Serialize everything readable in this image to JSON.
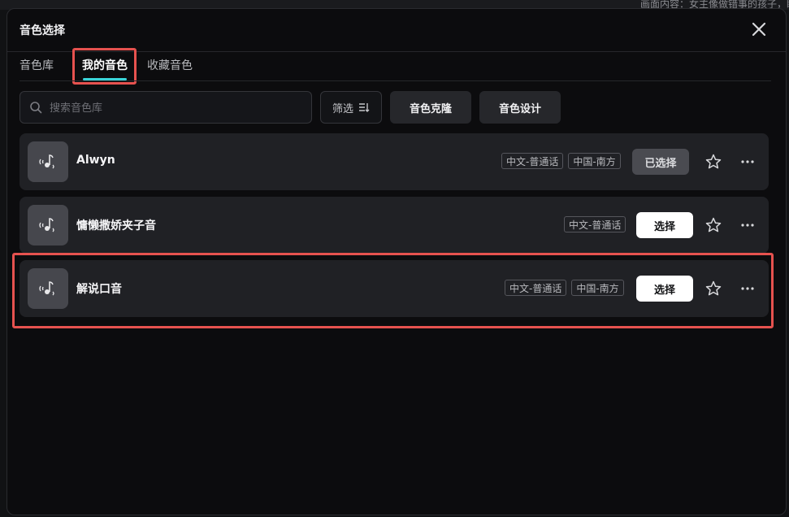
{
  "background": {
    "overlay_text": "画面内容：女主像做错事的孩子，眼"
  },
  "modal": {
    "title": "音色选择",
    "close_icon": "close-icon"
  },
  "tabs": [
    {
      "label": "音色库",
      "active": false
    },
    {
      "label": "我的音色",
      "active": true
    },
    {
      "label": "收藏音色",
      "active": false
    }
  ],
  "toolbar": {
    "search_placeholder": "搜索音色库",
    "search_value": "",
    "filter_label": "筛选",
    "clone_label": "音色克隆",
    "design_label": "音色设计"
  },
  "voices": [
    {
      "name": "Alwyn",
      "tags": [
        "中文-普通话",
        "中国-南方"
      ],
      "button": "已选择",
      "selected": true
    },
    {
      "name": "慵懒撒娇夹子音",
      "tags": [
        "中文-普通话"
      ],
      "button": "选择",
      "selected": false
    },
    {
      "name": "解说口音",
      "tags": [
        "中文-普通话",
        "中国-南方"
      ],
      "button": "选择",
      "selected": false
    }
  ],
  "colors": {
    "accent_underline": "#3ad4d8",
    "highlight_box": "#e6524f",
    "card_bg": "#202125",
    "modal_bg": "#0c0c0e"
  }
}
